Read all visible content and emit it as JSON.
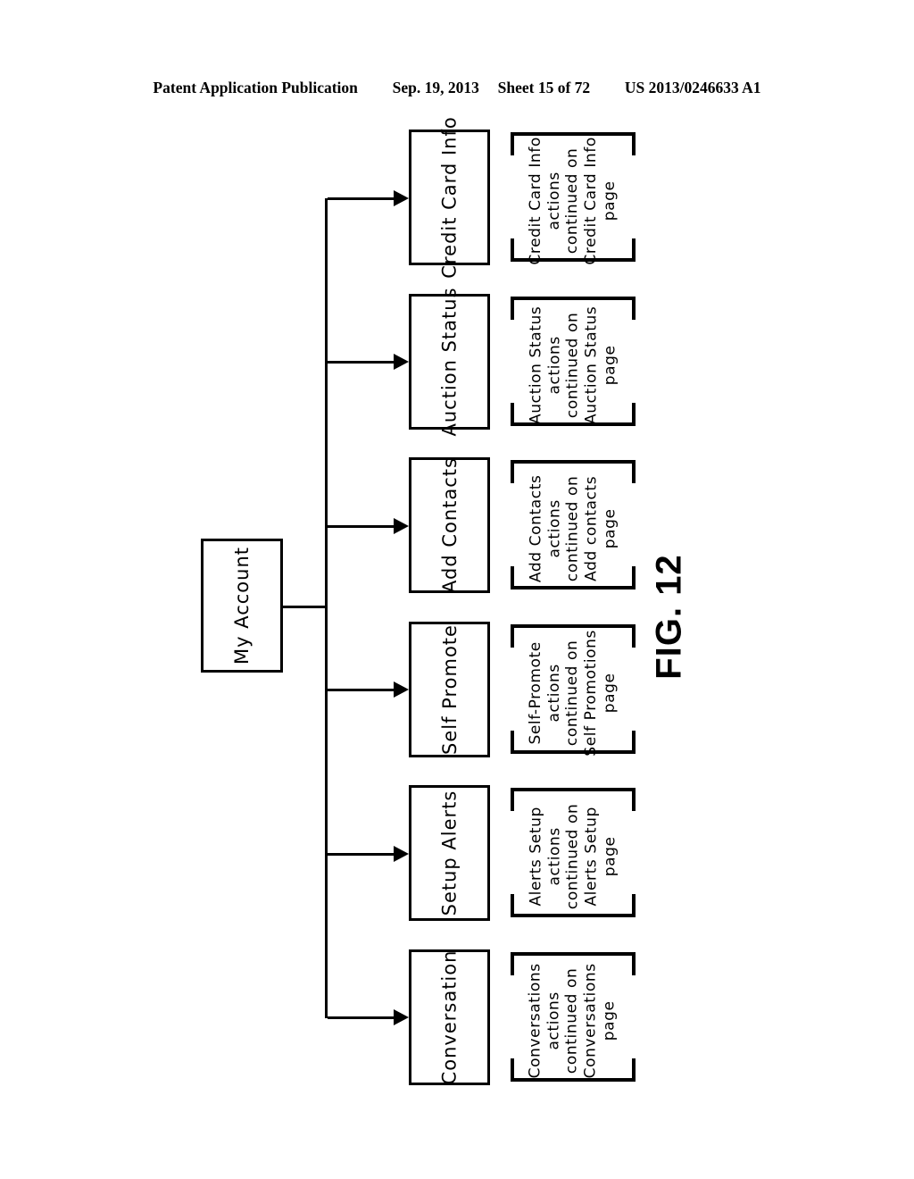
{
  "header": {
    "publication": "Patent Application Publication",
    "date": "Sep. 19, 2013",
    "sheet": "Sheet 15 of 72",
    "patent_number": "US 2013/0246633 A1"
  },
  "figure": {
    "label": "FIG. 12"
  },
  "diagram": {
    "root": {
      "label": "My Account"
    },
    "nodes": [
      {
        "label": "Credit Card Info",
        "annotation": [
          "Credit Card Info",
          "actions",
          "continued on",
          "Credit Card Info",
          "page"
        ]
      },
      {
        "label": "Auction Status",
        "annotation": [
          "Auction Status",
          "actions",
          "continued on",
          "Auction Status",
          "page"
        ]
      },
      {
        "label": "Add Contacts",
        "annotation": [
          "Add Contacts",
          "actions",
          "continued on",
          "Add contacts",
          "page"
        ]
      },
      {
        "label": "Self Promote",
        "annotation": [
          "Self-Promote",
          "actions",
          "continued on",
          "Self Promotions",
          "page"
        ]
      },
      {
        "label": "Setup Alerts",
        "annotation": [
          "Alerts Setup",
          "actions",
          "continued on",
          "Alerts Setup",
          "page"
        ]
      },
      {
        "label": "Conversation",
        "annotation": [
          "Conversations",
          "actions",
          "continued on",
          "Conversations",
          "page"
        ]
      }
    ]
  },
  "colors": {
    "ink": "#000000",
    "paper": "#ffffff"
  }
}
